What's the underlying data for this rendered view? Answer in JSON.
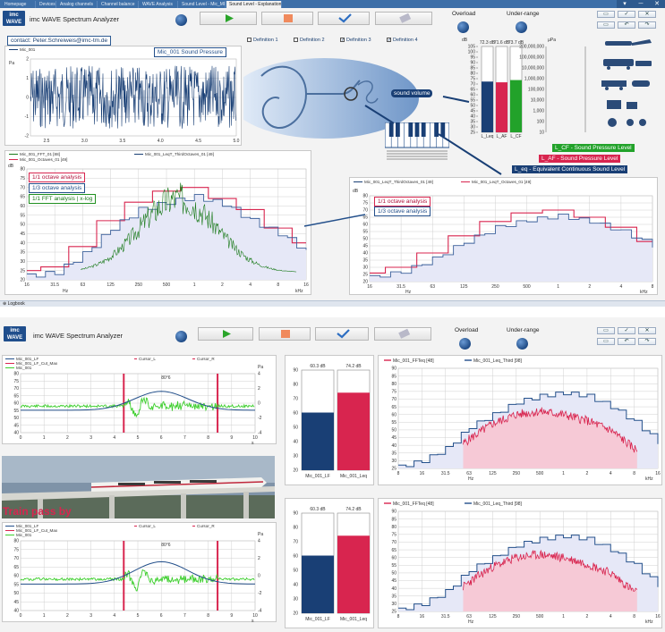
{
  "tabs": [
    "Homepage",
    "Devices",
    "Analog channels",
    "Channel balance",
    "WAVE Analysis",
    "Sound Level - Mic_MIC",
    "Sound Level - Explanation"
  ],
  "active_tab": 6,
  "window_controls": [
    "▾",
    "─",
    "✕"
  ],
  "app": {
    "logo_line1": "imc",
    "logo_line2": "WAVE",
    "title": "imc WAVE Spectrum Analyzer",
    "overload_label": "Overload",
    "underrange_label": "Under-range"
  },
  "top": {
    "contact": "contact: Peter.Schreiweis@imc-tm.de",
    "definitions": [
      "Definition 1",
      "Definition 2",
      "Definition 3",
      "Definition 4"
    ],
    "time_legend": "Mic_001",
    "time_title_box": "Mic_001 Sound Pressure",
    "time_unit": "Pa",
    "time_x_ticks": [
      "2.5",
      "3.0",
      "3.5",
      "4.0",
      "4.5",
      "5.0"
    ],
    "time_x_unit": "s",
    "sound_volume": "sound volume",
    "levels": {
      "values": [
        "72.3 dB",
        "71.6 dB",
        "73.7 dB"
      ],
      "names": [
        "L_Leq",
        "L_AF",
        "L_CF"
      ],
      "unit": "dB",
      "y_ticks": [
        "105",
        "100",
        "95",
        "90",
        "85",
        "80",
        "75",
        "70",
        "65",
        "60",
        "55",
        "50",
        "45",
        "40",
        "35",
        "30",
        "25"
      ],
      "pa_ticks": [
        "200,000,000",
        "100,000,000",
        "10,000,000",
        "1,000,000",
        "100,000",
        "10,000",
        "1,000",
        "100",
        "10"
      ],
      "pa_unit": "µPa"
    },
    "level_labels": [
      "L_CF - Sound Pressure Level",
      "L_AF - Sound Pressure Level",
      "L_eq - Equivalent Continuous Sound Level"
    ],
    "spec_legends": [
      "Mic_001_FFT_01 [88]",
      "Mic_001_Octaves_01 [49]",
      "Mic_001_LeqT_ThirdOctaves_01 [49]"
    ],
    "spec_boxes": [
      "1/1 octave analysis",
      "1/3 octave analysis",
      "1/1 FFT analysis | x-log"
    ],
    "spec_y_unit": "dB",
    "spec_y_ticks": [
      "80",
      "75",
      "70",
      "65",
      "60",
      "55",
      "50",
      "45",
      "40",
      "35",
      "30",
      "25",
      "20"
    ],
    "spec_x_ticks": [
      "16",
      "31.5",
      "63",
      "125",
      "250",
      "500",
      "1",
      "2",
      "4",
      "8",
      "16"
    ],
    "spec_x_units": [
      "Hz",
      "kHz"
    ],
    "spec2_legends": [
      "Mic_001_LeqT_ThirdOctaves_01 [49]",
      "Mic_001_LeqT_Octaves_01 [49]"
    ],
    "spec2_boxes": [
      "1/1 octave analysis",
      "1/3 octave analysis"
    ],
    "spec2_y_ticks": [
      "80",
      "75",
      "70",
      "65",
      "60",
      "55",
      "50",
      "45",
      "40",
      "35",
      "30",
      "25",
      "20"
    ],
    "spec2_x_ticks": [
      "16",
      "31.5",
      "63",
      "125",
      "250",
      "500",
      "1",
      "2",
      "4",
      "8"
    ],
    "logbook": "Logbook"
  },
  "bottom": {
    "trace_legends": [
      "Mic_001_LF",
      "Mic_001_LF_Cut_Max",
      "Mic_001"
    ],
    "cursor_labels": [
      "Cursor_L",
      "Cursor_R"
    ],
    "marker_label": "80°6",
    "trace_y_ticks": [
      "80",
      "75",
      "70",
      "65",
      "60",
      "55",
      "50",
      "45",
      "40"
    ],
    "trace_y2_ticks": [
      "4",
      "2",
      "0",
      "-2",
      "-4"
    ],
    "trace_y2_unit": "Pa",
    "trace_x_ticks": [
      "0",
      "1",
      "2",
      "3",
      "4",
      "5",
      "6",
      "7",
      "8",
      "9",
      "10"
    ],
    "trace_x_unit": "s",
    "train_caption": "Train pass by",
    "bar_values": [
      "60.3 dB",
      "74.2 dB"
    ],
    "bar_names": [
      "Mic_001_LF",
      "Mic_001_Leq"
    ],
    "bar_y_ticks": [
      "90",
      "80",
      "70",
      "60",
      "50",
      "40",
      "30",
      "20"
    ],
    "spec_legends": [
      "Mic_001_FFTeq [48]",
      "Mic_001_Leq_Third [98]"
    ],
    "spec_y_ticks": [
      "90",
      "85",
      "80",
      "75",
      "70",
      "65",
      "60",
      "55",
      "50",
      "45",
      "40",
      "35",
      "30",
      "25"
    ],
    "spec_x_ticks": [
      "8",
      "16",
      "31.5",
      "63",
      "125",
      "250",
      "500",
      "1",
      "2",
      "4",
      "8",
      "16"
    ],
    "spec_x_units": [
      "Hz",
      "kHz"
    ]
  },
  "colors": {
    "navy": "#193f75",
    "red": "#d8254f",
    "green": "#22a22a",
    "fft_green": "#1a7a1a",
    "accent": "#3d6fa8"
  },
  "chart_data": [
    {
      "type": "line",
      "title": "Mic_001 Sound Pressure",
      "xlabel": "s",
      "ylabel": "Pa",
      "xlim": [
        2.3,
        5.0
      ],
      "series": [
        {
          "name": "Mic_001",
          "description_values": "noise signal approx. -1.5..1.5 Pa"
        }
      ]
    },
    {
      "type": "bar",
      "categories": [
        "L_Leq",
        "L_AF",
        "L_CF"
      ],
      "values": [
        72.3,
        71.6,
        73.7
      ],
      "ylabel": "dB",
      "ylim": [
        25,
        105
      ]
    },
    {
      "type": "line",
      "title": "",
      "xlabel": "Hz",
      "ylabel": "dB",
      "ylim": [
        20,
        80
      ],
      "x": [
        16,
        31.5,
        63,
        125,
        250,
        500,
        1000,
        2000,
        4000,
        8000,
        16000
      ],
      "series": [
        {
          "name": "Mic_001_Octaves_01 [49]",
          "values": [
            25,
            27,
            38,
            52,
            62,
            68,
            70,
            64,
            58,
            48,
            40
          ]
        },
        {
          "name": "Mic_001_LeqT_ThirdOctaves_01 [49]",
          "values": [
            22,
            24,
            34,
            48,
            58,
            62,
            65,
            61,
            52,
            45,
            35
          ]
        }
      ]
    },
    {
      "type": "line",
      "xlabel": "Hz",
      "ylabel": "dB",
      "ylim": [
        20,
        80
      ],
      "x": [
        16,
        31.5,
        63,
        125,
        250,
        500,
        1000,
        2000,
        4000,
        8000
      ],
      "series": [
        {
          "name": "Mic_001_LeqT_Octaves_01 [49]",
          "values": [
            26,
            30,
            40,
            52,
            62,
            68,
            70,
            65,
            58,
            48
          ]
        },
        {
          "name": "Mic_001_LeqT_ThirdOctaves_01 [49]",
          "values": [
            23,
            27,
            36,
            48,
            58,
            63,
            66,
            62,
            55,
            45
          ]
        }
      ]
    },
    {
      "type": "bar",
      "categories": [
        "Mic_001_LF",
        "Mic_001_Leq"
      ],
      "values": [
        60.3,
        74.2
      ],
      "ylabel": "dB",
      "ylim": [
        20,
        90
      ]
    },
    {
      "type": "line",
      "xlabel": "Hz",
      "ylabel": "dB",
      "ylim": [
        25,
        90
      ],
      "x": [
        8,
        16,
        31.5,
        63,
        125,
        250,
        500,
        1000,
        2000,
        4000,
        8000,
        16000
      ],
      "series": [
        {
          "name": "Mic_001_Leq_Third [98]",
          "values": [
            26,
            30,
            38,
            52,
            60,
            68,
            72,
            74,
            72,
            65,
            55,
            42
          ]
        },
        {
          "name": "Mic_001_FFTeq [48]",
          "values": [
            25,
            27,
            32,
            44,
            54,
            60,
            62,
            60,
            56,
            50,
            38,
            30
          ]
        }
      ]
    }
  ]
}
